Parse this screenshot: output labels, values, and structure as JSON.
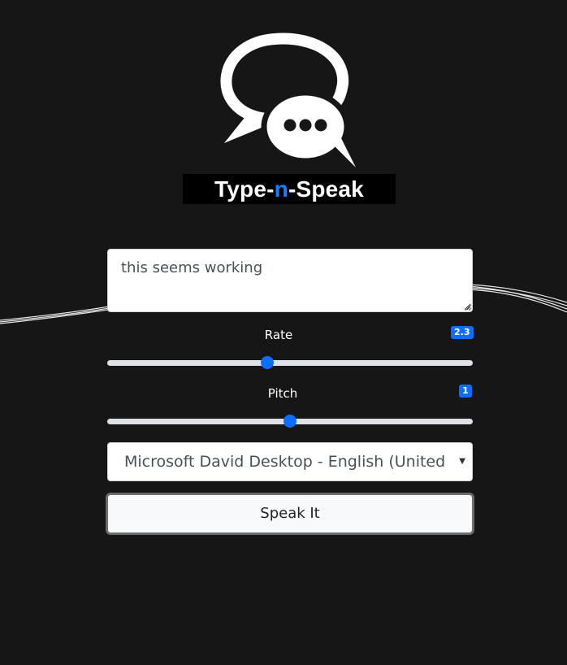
{
  "brand": {
    "part1": "Type-",
    "part2": "n",
    "part3": "-Speak"
  },
  "form": {
    "text_value": "this seems working",
    "rate": {
      "label": "Rate",
      "value": "2.3",
      "fraction": 0.435
    },
    "pitch": {
      "label": "Pitch",
      "value": "1",
      "fraction": 0.5
    },
    "voice": {
      "selected": "Microsoft David Desktop - English (United States)"
    },
    "speak_label": "Speak It"
  },
  "icons": {
    "logo": "speech-bubbles-icon",
    "select_arrow": "caret-down-icon"
  },
  "colors": {
    "background": "#161617",
    "accent": "#0d6efd",
    "brand_accent": "#1d7bff"
  }
}
